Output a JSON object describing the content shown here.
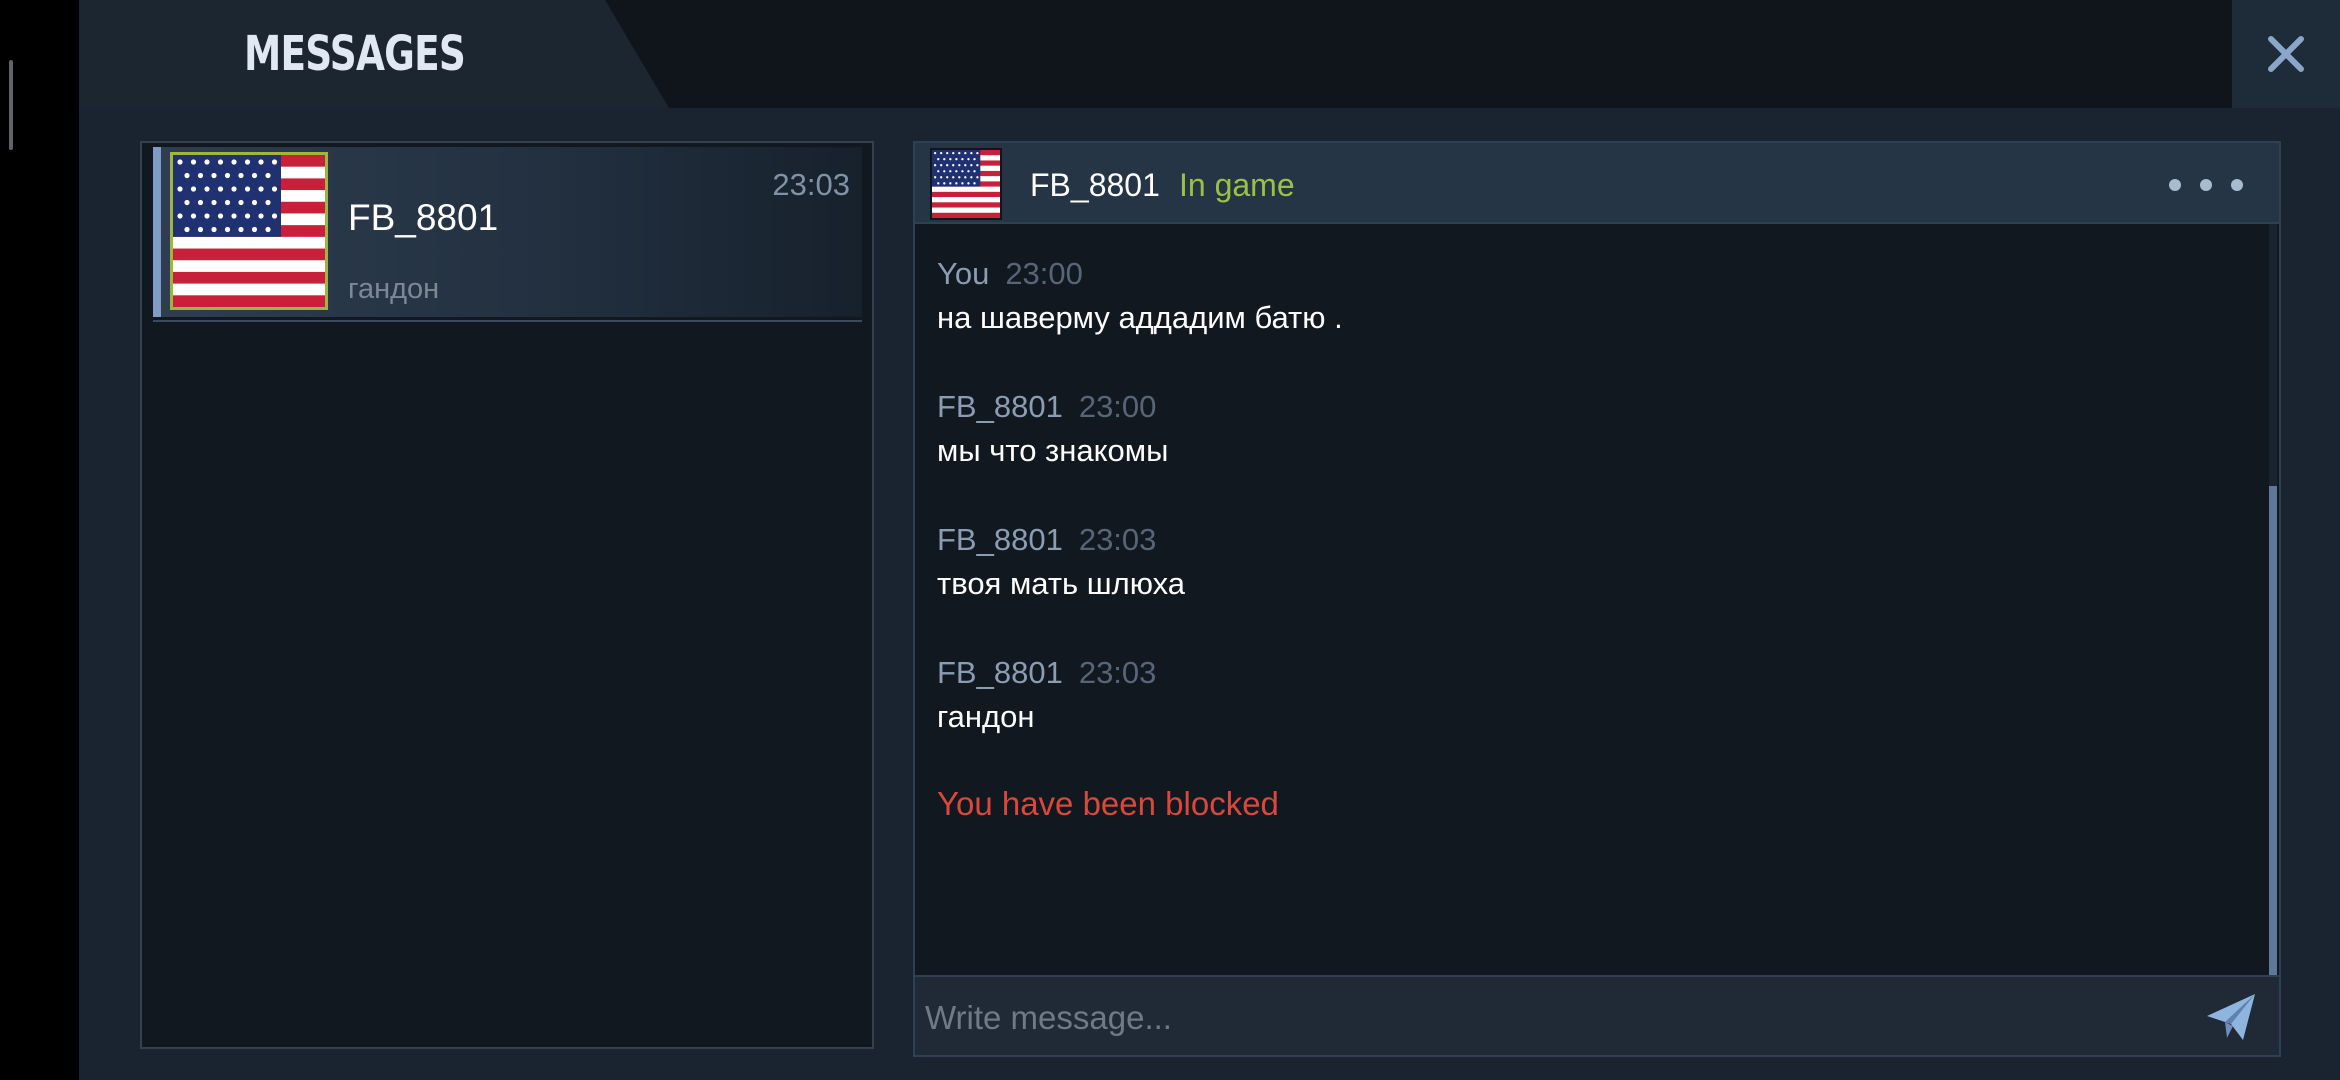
{
  "header": {
    "title": "MESSAGES",
    "close_icon": "close-icon"
  },
  "conversations": [
    {
      "name": "FB_8801",
      "time": "23:03",
      "preview": "гандон",
      "avatar": "us-flag-avatar"
    }
  ],
  "chat": {
    "contact_name": "FB_8801",
    "status": "In game",
    "more_icon": "more-dots-icon",
    "messages": [
      {
        "author": "You",
        "time": "23:00",
        "text": "на шаверму аддадим батю ."
      },
      {
        "author": "FB_8801",
        "time": "23:00",
        "text": "мы что знакомы"
      },
      {
        "author": "FB_8801",
        "time": "23:03",
        "text": "твоя мать шлюха"
      },
      {
        "author": "FB_8801",
        "time": "23:03",
        "text": "гандон"
      }
    ],
    "blocked_notice": "You have been blocked",
    "input_placeholder": "Write message...",
    "send_icon": "paper-plane-icon"
  },
  "colors": {
    "status_online": "#9bc143",
    "blocked": "#d9483a",
    "accent": "#7f9cc6"
  }
}
